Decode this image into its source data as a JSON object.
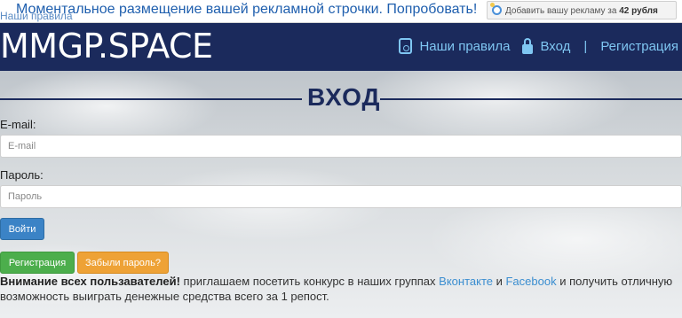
{
  "ad": {
    "behind_text": "Наши правила",
    "text": "Моментальное размещение вашей рекламной строчки. Попробовать!",
    "buy_prefix": "Добавить вашу рекламу за",
    "buy_price": "42 рубля"
  },
  "header": {
    "logo": "MMGP.SPACE",
    "nav": {
      "rules": "Наши правила",
      "login": "Вход",
      "separator": "|",
      "register": "Регистрация"
    }
  },
  "form": {
    "title": "ВХОД",
    "email_label": "E-mail:",
    "email_placeholder": "E-mail",
    "password_label": "Пароль:",
    "password_placeholder": "Пароль",
    "login_button": "Войти",
    "register_button": "Регистрация",
    "forgot_button": "Забыли пароль?"
  },
  "notice": {
    "bold": "Внимание всех пользавателей!",
    "part1": " приглашаем посетить конкурс в наших группах ",
    "vk": "Вконтакте",
    "and": " и ",
    "fb": "Facebook",
    "part2": " и получить отличную возможность выиграть денежные средства всего за 1 репост."
  },
  "colors": {
    "header_bg": "#1b2a5c",
    "nav_link": "#7fc6f2",
    "login_btn": "#3b83c6",
    "register_btn": "#4cae4c",
    "forgot_btn": "#eea236"
  }
}
